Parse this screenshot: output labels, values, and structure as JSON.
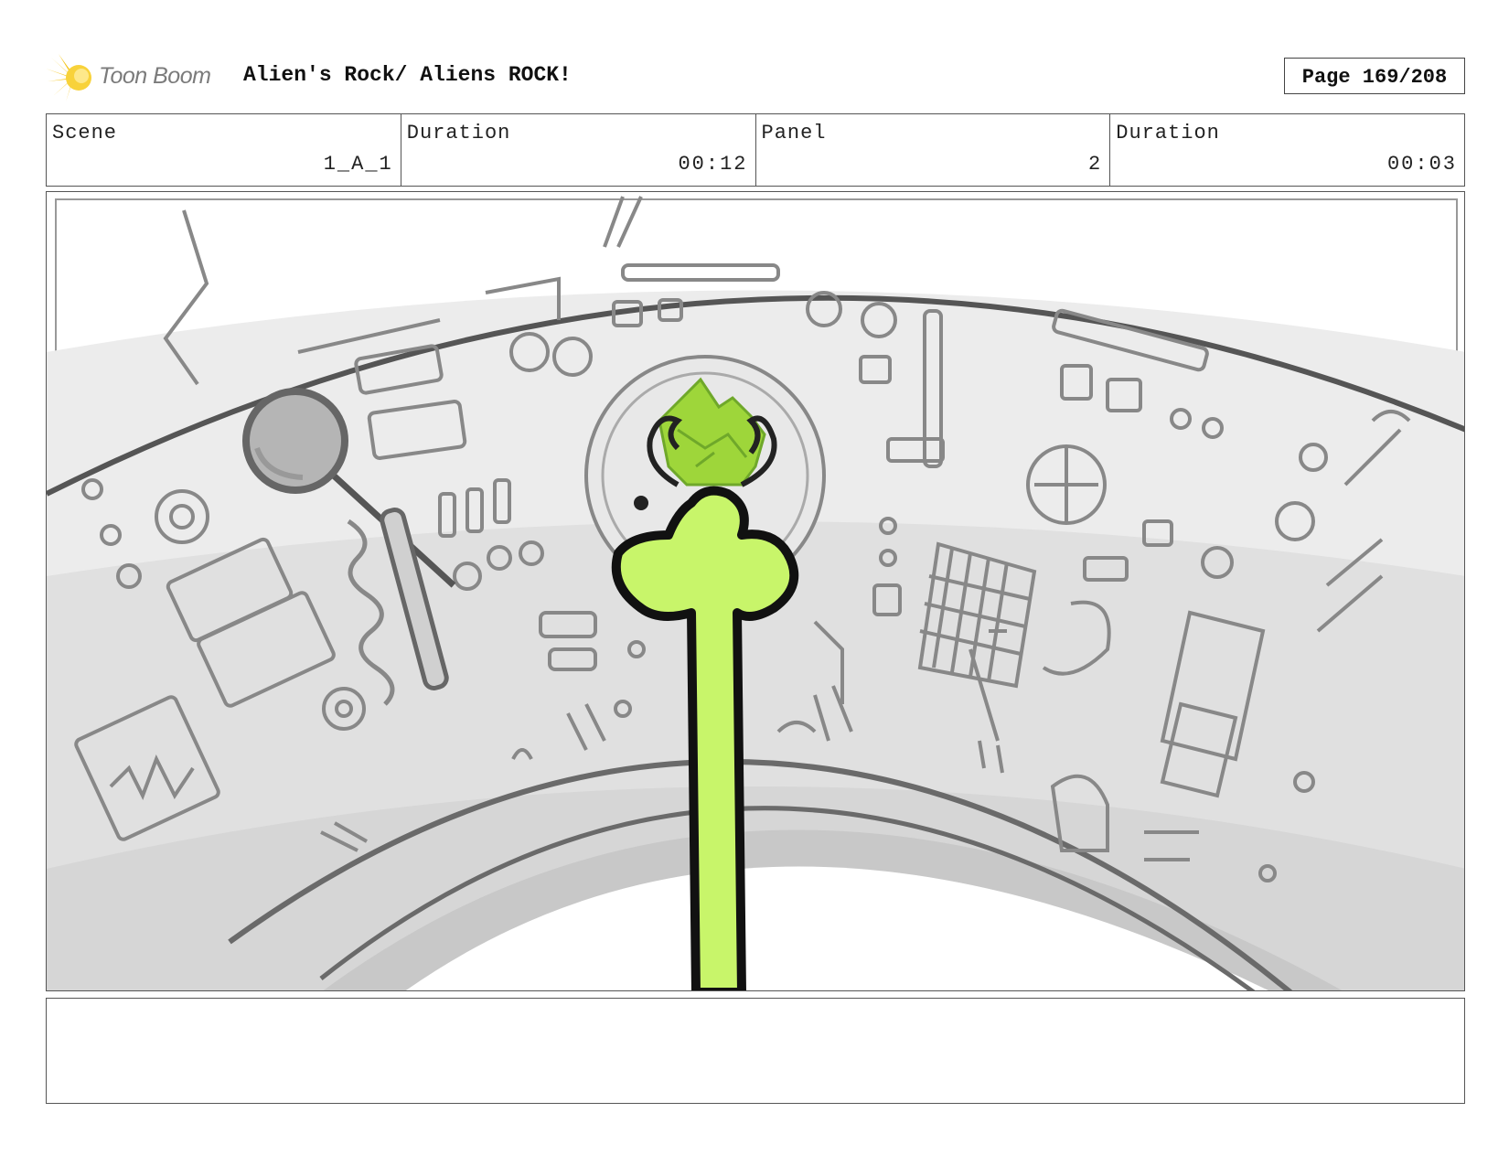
{
  "header": {
    "logo_text": "Toon Boom",
    "title": "Alien's Rock/ Aliens ROCK!",
    "page_label": "Page 169/208"
  },
  "info": [
    {
      "label": "Scene",
      "value": "1_A_1"
    },
    {
      "label": "Duration",
      "value": "00:12"
    },
    {
      "label": "Panel",
      "value": "2"
    },
    {
      "label": "Duration",
      "value": "00:03"
    }
  ],
  "notes": {
    "text": ""
  },
  "colors": {
    "alien_green": "#c8f56a",
    "crystal_green": "#9ed63a",
    "sketch_gray": "#7a7a7a",
    "shade_gray": "#d9d9d9",
    "logo_yellow": "#f5c518"
  }
}
